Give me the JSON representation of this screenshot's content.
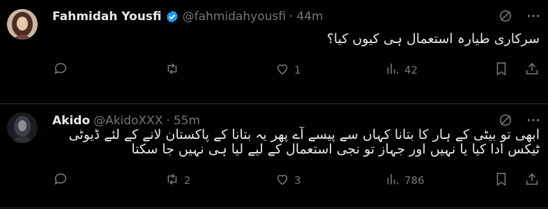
{
  "tweets": [
    {
      "author": "Fahmidah Yousfi",
      "handle": "@fahmidahyousfi",
      "time": "44m",
      "verified": true,
      "text_lines": [
        "سرکاری طیارہ استعمال ہی کیوں کیا؟"
      ],
      "replies": "",
      "retweets": "",
      "likes": "1",
      "views": "42"
    },
    {
      "author": "Akido",
      "handle": "@AkidoXXX",
      "time": "55m",
      "verified": false,
      "text_lines": [
        "ابھی تو بیٹی کے ہار کا  بتانا کہاں سے پیسے آے پھر یہ بتانا کے پاکستان لانے کے لئے ڈیوٹی",
        "ٹیکس ادا کیا یا نہیں اور جہاز تو نجی استعمال کے لیے لیا ہی نہیں جا سکتا"
      ],
      "replies": "",
      "retweets": "2",
      "likes": "3",
      "views": "786"
    }
  ],
  "separator": "·",
  "icons": {
    "verified": "verified-badge-icon",
    "grok": "grok-icon",
    "more": "more-icon",
    "reply": "reply-icon",
    "retweet": "retweet-icon",
    "like": "like-icon",
    "views": "views-icon",
    "bookmark": "bookmark-icon",
    "share": "share-icon"
  },
  "colors": {
    "background": "#000000",
    "text": "#e7e9ea",
    "muted": "#71767b",
    "verified": "#1d9bf0",
    "divider": "#2f3336"
  }
}
